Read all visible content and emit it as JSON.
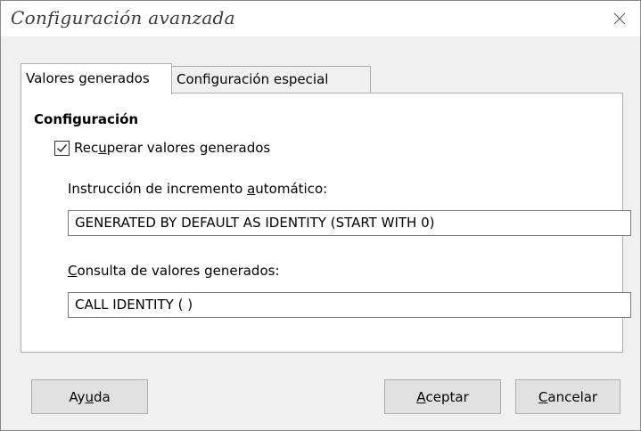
{
  "window": {
    "title": "Configuración avanzada"
  },
  "tabs": [
    {
      "label": "Valores generados",
      "active": true
    },
    {
      "label": "Configuración especial",
      "active": false
    }
  ],
  "panel": {
    "section_title": "Configuración",
    "retrieve_checkbox": {
      "pre": "Rec",
      "mnemonic": "u",
      "post": "perar valores generados",
      "checked": true
    },
    "autoincrement": {
      "label_pre": "Instrucción de incremento ",
      "label_mnemonic": "a",
      "label_post": "utomático:",
      "value": "GENERATED BY DEFAULT AS IDENTITY (START WITH 0)"
    },
    "query": {
      "label_mnemonic": "C",
      "label_post": "onsulta de valores generados:",
      "value": "CALL IDENTITY ( )"
    }
  },
  "buttons": {
    "help": {
      "pre": "Ay",
      "mnemonic": "u",
      "post": "da"
    },
    "ok": {
      "mnemonic": "A",
      "post": "ceptar"
    },
    "cancel": {
      "mnemonic": "C",
      "post": "ancelar"
    }
  },
  "icons": {
    "close": "close-icon",
    "check": "checkmark-icon"
  }
}
